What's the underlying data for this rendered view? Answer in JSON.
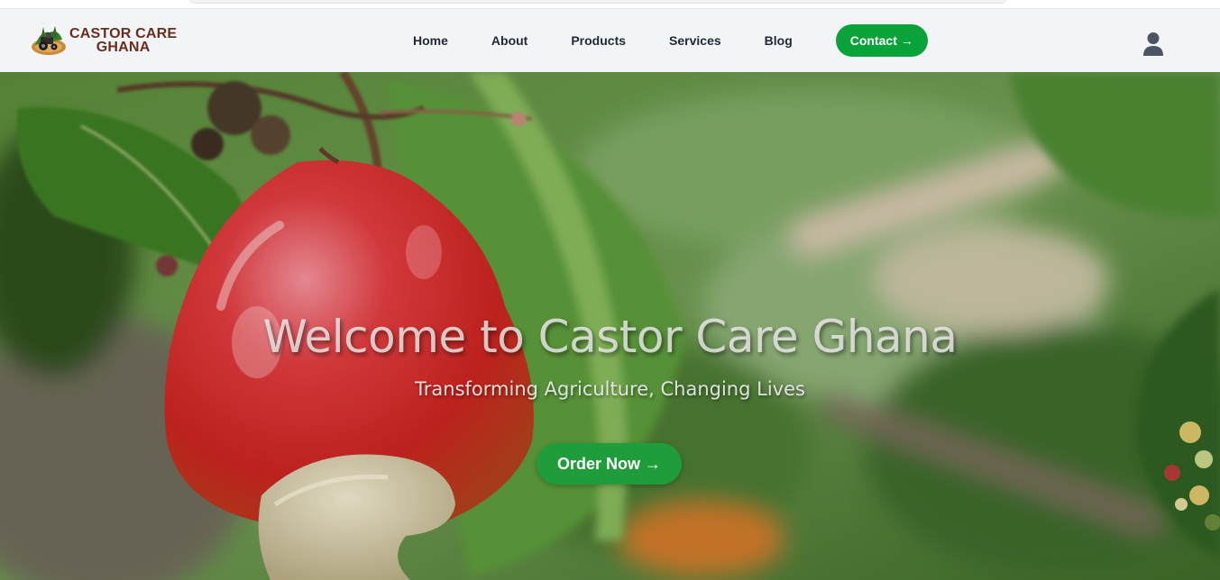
{
  "brand": {
    "line1": "CASTOR CARE",
    "line2": "GHANA"
  },
  "nav": {
    "items": [
      {
        "label": "Home"
      },
      {
        "label": "About"
      },
      {
        "label": "Products"
      },
      {
        "label": "Services"
      },
      {
        "label": "Blog"
      }
    ],
    "contact_label": "Contact →"
  },
  "hero": {
    "title": "Welcome to Castor Care Ghana",
    "subtitle": "Transforming Agriculture, Changing Lives",
    "cta_label": "Order Now →"
  },
  "colors": {
    "brand_text": "#6b2c1f",
    "accent_green": "#0aa33a",
    "cta_green": "#1e9d3a",
    "navbar_bg": "#f3f4f6"
  },
  "icons": {
    "user": "user-icon",
    "logo": "tractor-logo-icon"
  }
}
